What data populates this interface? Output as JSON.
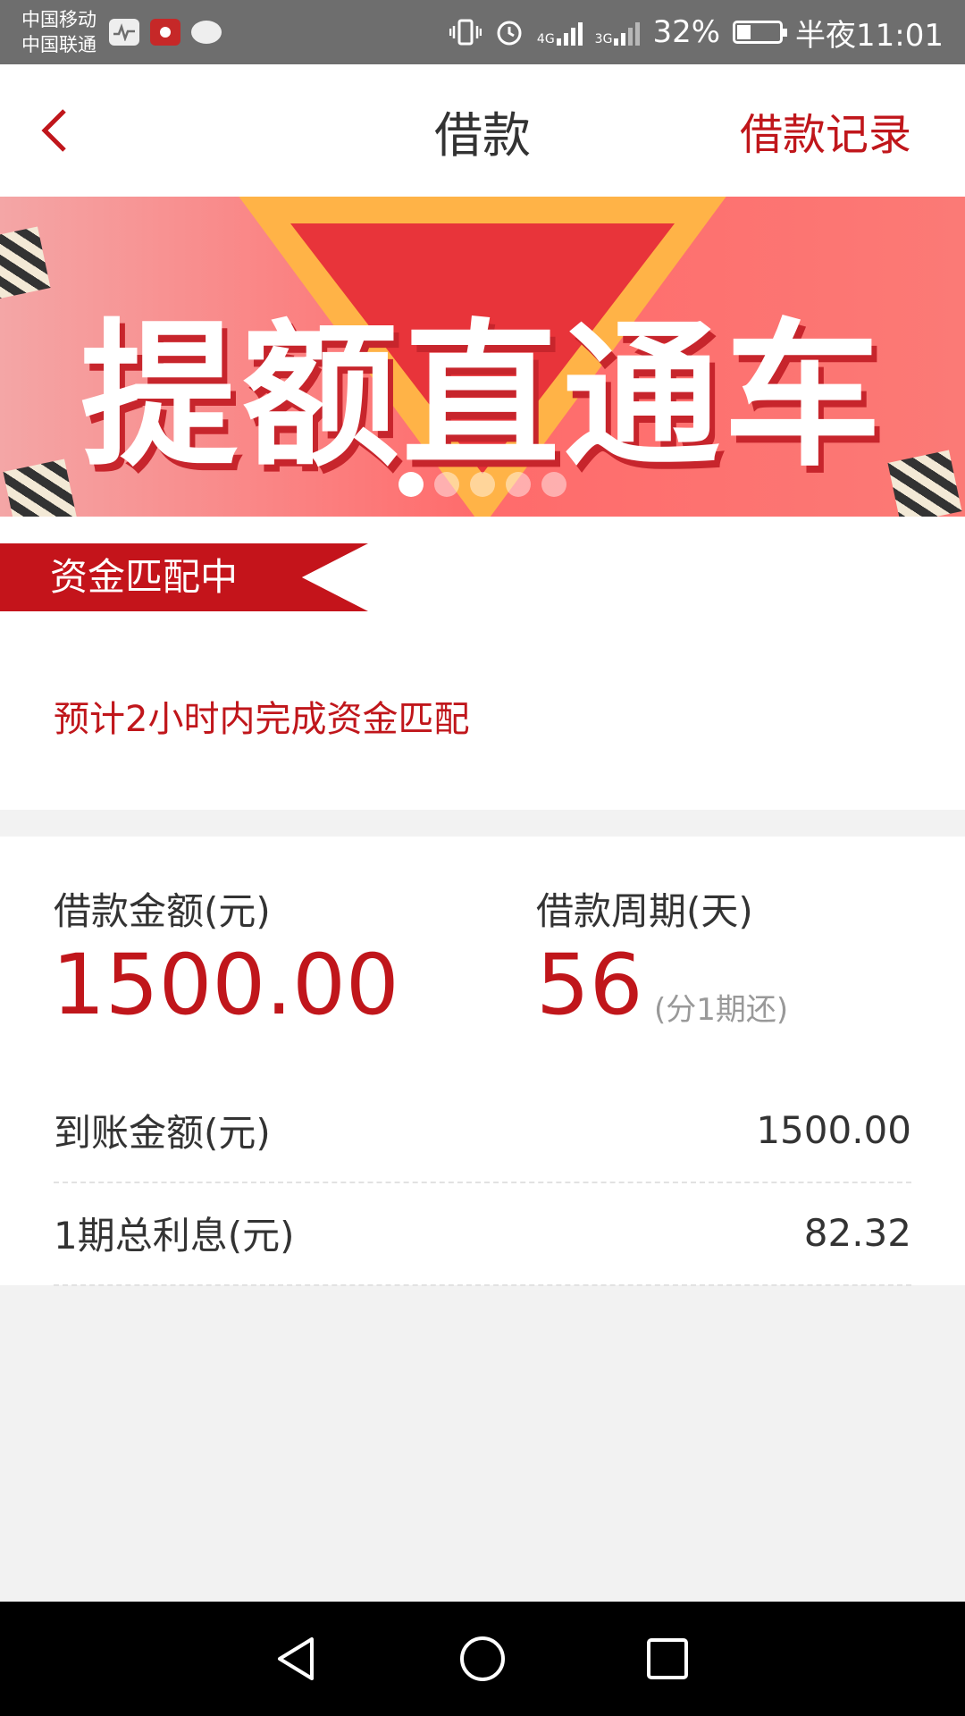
{
  "status_bar": {
    "carrier_1": "中国移动",
    "carrier_2": "中国联通",
    "net_4g": "4G",
    "net_3g": "3G",
    "battery": "32%",
    "battery_level": 0.32,
    "time": "半夜11:01"
  },
  "header": {
    "title": "借款",
    "record_link": "借款记录",
    "accent_color": "#c0161b"
  },
  "banner": {
    "text": "提额直通车",
    "slide_count": 5,
    "active_slide": 1
  },
  "status": {
    "badge": "资金匹配中",
    "estimate": "预计2小时内完成资金匹配"
  },
  "loan": {
    "amount_label": "借款金额(元)",
    "amount_value": "1500.00",
    "period_label": "借款周期(天)",
    "period_value": "56",
    "period_note": "(分1期还)",
    "received_label": "到账金额(元)",
    "received_value": "1500.00",
    "interest_label": "1期总利息(元)",
    "interest_value": "82.32"
  }
}
